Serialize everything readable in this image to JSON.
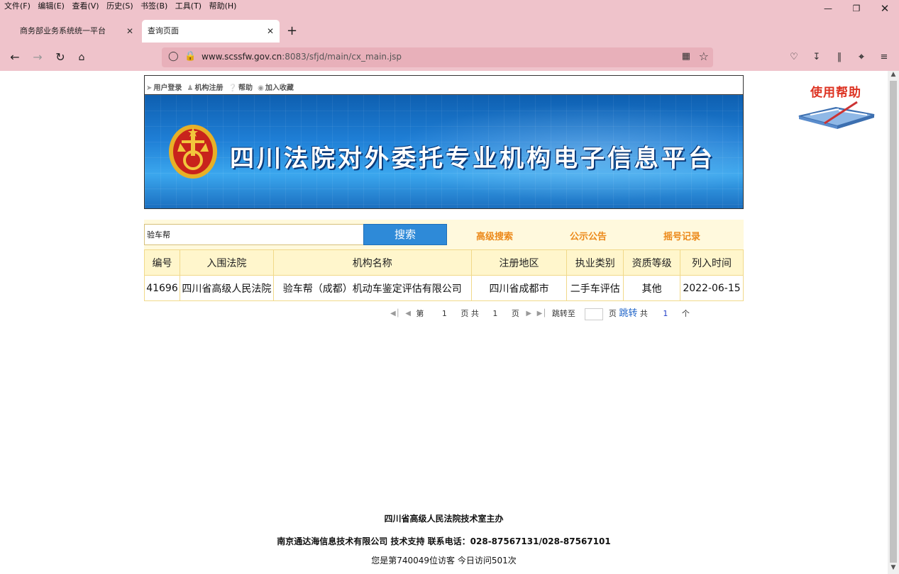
{
  "browser": {
    "menu": [
      "文件(F)",
      "编辑(E)",
      "查看(V)",
      "历史(S)",
      "书签(B)",
      "工具(T)",
      "帮助(H)"
    ],
    "tabs": [
      {
        "label": "商务部业务系统统一平台",
        "active": false
      },
      {
        "label": "查询页面",
        "active": true
      }
    ],
    "url_host": "www.scssfw.gov.cn",
    "url_path": ":8083/sfjd/main/cx_main.jsp",
    "chrome_color": "#efc3cb"
  },
  "topbar": {
    "links": [
      {
        "icon": "login-icon",
        "label": "用户登录"
      },
      {
        "icon": "user-register-icon",
        "label": "机构注册"
      },
      {
        "icon": "help-icon",
        "label": "帮助"
      },
      {
        "icon": "favorite-icon",
        "label": "加入收藏"
      }
    ]
  },
  "banner": {
    "title": "四川法院对外委托专业机构电子信息平台"
  },
  "help_badge": {
    "label": "使用帮助"
  },
  "search": {
    "value": "验车帮",
    "button_label": "搜索",
    "links": [
      "高级搜索",
      "公示公告",
      "摇号记录"
    ],
    "accent_color": "#ec8a1b",
    "button_color": "#2e8ad8"
  },
  "results": {
    "columns": [
      "编号",
      "入围法院",
      "机构名称",
      "注册地区",
      "执业类别",
      "资质等级",
      "列入时间"
    ],
    "rows": [
      [
        "41696",
        "四川省高级人民法院",
        "验车帮（成都）机动车鉴定评估有限公司",
        "四川省成都市",
        "二手车评估",
        "其他",
        "2022-06-15"
      ]
    ]
  },
  "pager": {
    "first_icon": "first-page-icon",
    "prev_icon": "prev-page-icon",
    "page_prefix": "第",
    "current_page": "1",
    "page_suffix_total": "页 共",
    "total_pages": "1",
    "page_unit": "页",
    "next_icon": "next-page-icon",
    "last_icon": "last-page-icon",
    "jump_to": "跳转至",
    "page_unit2": "页",
    "jump_button": "跳转",
    "total_prefix": "共",
    "total_count": "1",
    "total_unit": "个"
  },
  "footer": {
    "host": "四川省高级人民法院技术室主办",
    "support": "南京通达海信息技术有限公司 技术支持 联系电话：028-87567131/028-87567101",
    "visits": "您是第740049位访客 今日访问501次"
  }
}
